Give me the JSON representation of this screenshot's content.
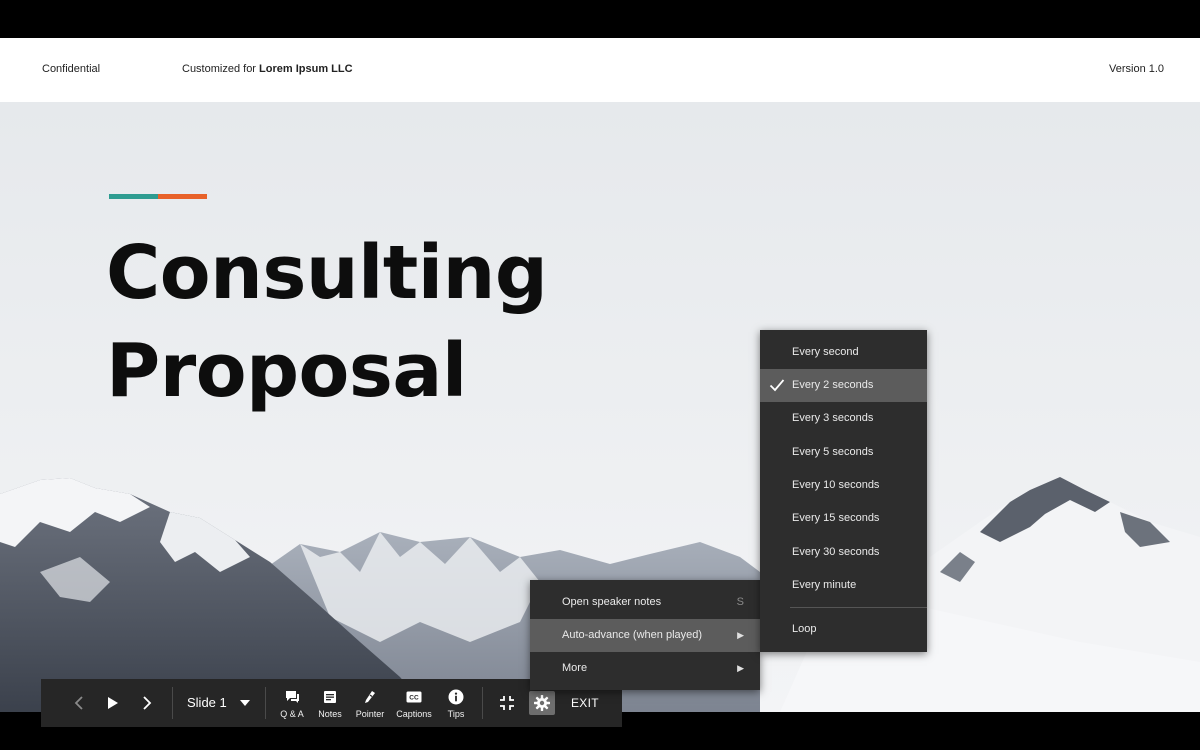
{
  "header": {
    "confidential": "Confidential",
    "customized_prefix": "Customized for ",
    "company": "Lorem Ipsum LLC",
    "version": "Version 1.0"
  },
  "slide": {
    "title_line1": "Consulting",
    "title_line2": "Proposal",
    "accent_colors": [
      "#2e9c91",
      "#e8622a"
    ]
  },
  "toolbar": {
    "slide_label": "Slide 1",
    "qa_label": "Q & A",
    "notes_label": "Notes",
    "pointer_label": "Pointer",
    "captions_label": "Captions",
    "tips_label": "Tips",
    "exit_label": "EXIT"
  },
  "options_menu": {
    "items": [
      {
        "label": "Open speaker notes",
        "shortcut": "S"
      },
      {
        "label": "Auto-advance (when played)"
      },
      {
        "label": "More"
      }
    ]
  },
  "auto_advance_menu": {
    "items": [
      {
        "label": "Every second"
      },
      {
        "label": "Every 2 seconds",
        "checked": true
      },
      {
        "label": "Every 3 seconds"
      },
      {
        "label": "Every 5 seconds"
      },
      {
        "label": "Every 10 seconds"
      },
      {
        "label": "Every 15 seconds"
      },
      {
        "label": "Every 30 seconds"
      },
      {
        "label": "Every minute"
      },
      {
        "label": "Loop"
      }
    ]
  },
  "colors": {
    "toolbar_bg": "#262626",
    "menu_bg": "#2d2d2d",
    "menu_active": "#5c5c5c"
  }
}
